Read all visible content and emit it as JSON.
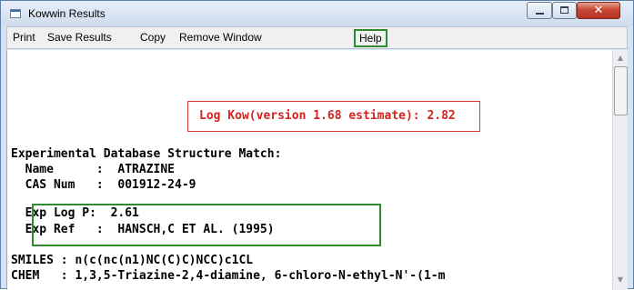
{
  "window": {
    "title": "Kowwin Results",
    "controls": {
      "minimize": "minimize",
      "maximize": "maximize",
      "close": "✕"
    }
  },
  "menu": {
    "print": "Print",
    "save_results": "Save Results",
    "copy": "Copy",
    "remove_window": "Remove Window",
    "help": "Help"
  },
  "result": {
    "log_kow": "Log Kow(version 1.68 estimate): 2.82"
  },
  "match": {
    "header": "Experimental Database Structure Match:",
    "name_line": "  Name      :  ATRAZINE",
    "cas_line": "  CAS Num   :  001912-24-9",
    "exp_logp_line": "  Exp Log P:  2.61",
    "exp_ref_line": "  Exp Ref   :  HANSCH,C ET AL. (1995)"
  },
  "smiles_line": "SMILES : n(c(nc(n1)NC(C)C)NCC)c1CL",
  "chem_line": "CHEM   : 1,3,5-Triazine-2,4-diamine, 6-chloro-N-ethyl-N'-(1-m",
  "colors": {
    "highlight_green": "#2e8b2e",
    "highlight_red": "#d43a3a",
    "result_text": "#d4231f"
  }
}
